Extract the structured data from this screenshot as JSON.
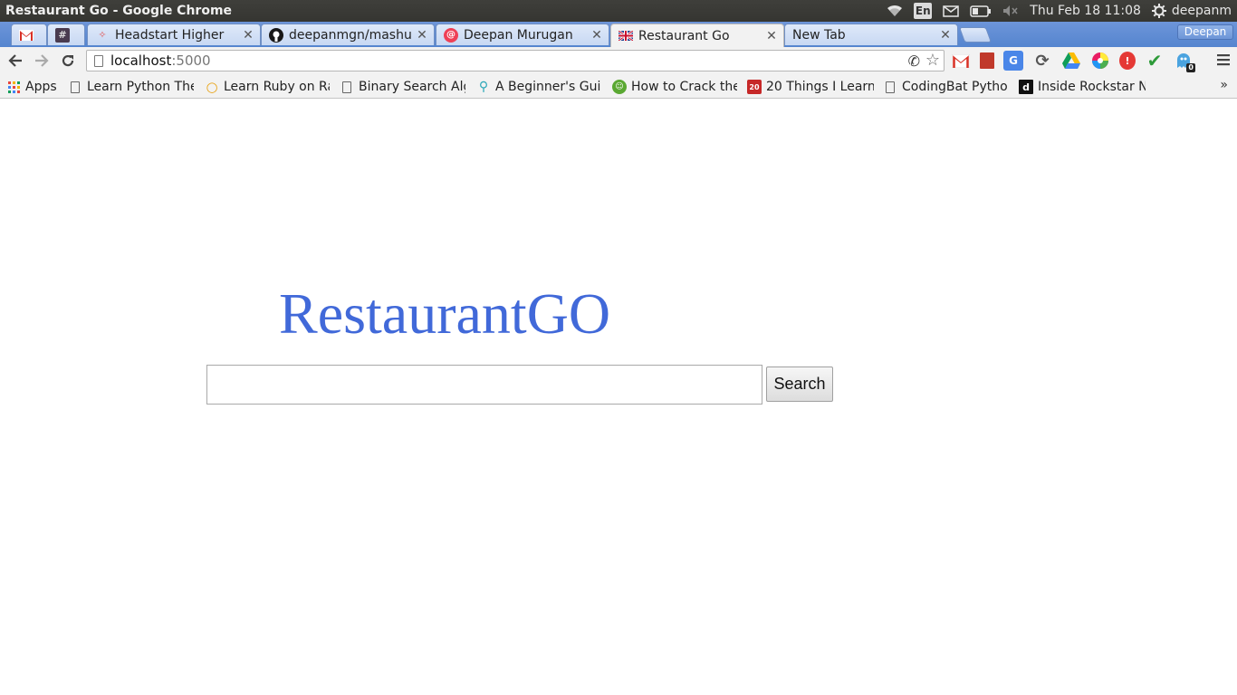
{
  "os_panel": {
    "window_title": "Restaurant Go - Google Chrome",
    "lang_indicator": "En",
    "clock": "Thu Feb 18 11:08",
    "user": "deepanm",
    "icons": [
      "wifi-icon",
      "mail-icon",
      "battery-icon",
      "volume-muted-icon",
      "power-gear-icon"
    ]
  },
  "tabs": [
    {
      "favicon": "gmail-icon",
      "title": ""
    },
    {
      "favicon": "hash-icon",
      "title": ""
    },
    {
      "favicon": "headstart-icon",
      "title": "Headstart Higher"
    },
    {
      "favicon": "github-icon",
      "title": "deepanmgn/mashup"
    },
    {
      "favicon": "pocket-icon",
      "title": "Deepan Murugan"
    },
    {
      "favicon": "uk-flag-icon",
      "title": "Restaurant Go"
    },
    {
      "favicon": "",
      "title": "New Tab"
    }
  ],
  "profile": {
    "name": "Deepan"
  },
  "toolbar": {
    "url_host": "localhost",
    "url_port": ":5000"
  },
  "extensions": [
    "gmail-ext-icon",
    "bookmark-ext-icon",
    "translate-ext-icon",
    "sync-ext-icon",
    "drive-ext-icon",
    "color-wheel-ext-icon",
    "adblock-ext-icon",
    "checkmark-ext-icon",
    "ghostery-ext-icon"
  ],
  "extension_badge": "0",
  "bookmarks": [
    {
      "icon": "apps-grid-icon",
      "label": "Apps"
    },
    {
      "icon": "page-icon",
      "label": "Learn Python The"
    },
    {
      "icon": "ruby-icon",
      "label": "Learn Ruby on Ra"
    },
    {
      "icon": "page-icon",
      "label": "Binary Search Alg"
    },
    {
      "icon": "guide-icon",
      "label": "A Beginner's Guic"
    },
    {
      "icon": "frog-icon",
      "label": "How to Crack the"
    },
    {
      "icon": "calendar-20-icon",
      "label": "20 Things I Learn"
    },
    {
      "icon": "page-icon",
      "label": "CodingBat Pytho"
    },
    {
      "icon": "rockstar-icon",
      "label": "Inside Rockstar N"
    }
  ],
  "bookmarks_overflow": "»",
  "main": {
    "logo_text": "RestaurantGO",
    "search_value": "",
    "search_button": "Search"
  },
  "colors": {
    "logo": "#4169d9",
    "tabstrip": "#5585cf",
    "toolbar": "#f2f2f2",
    "os_panel": "#3c3b37"
  }
}
